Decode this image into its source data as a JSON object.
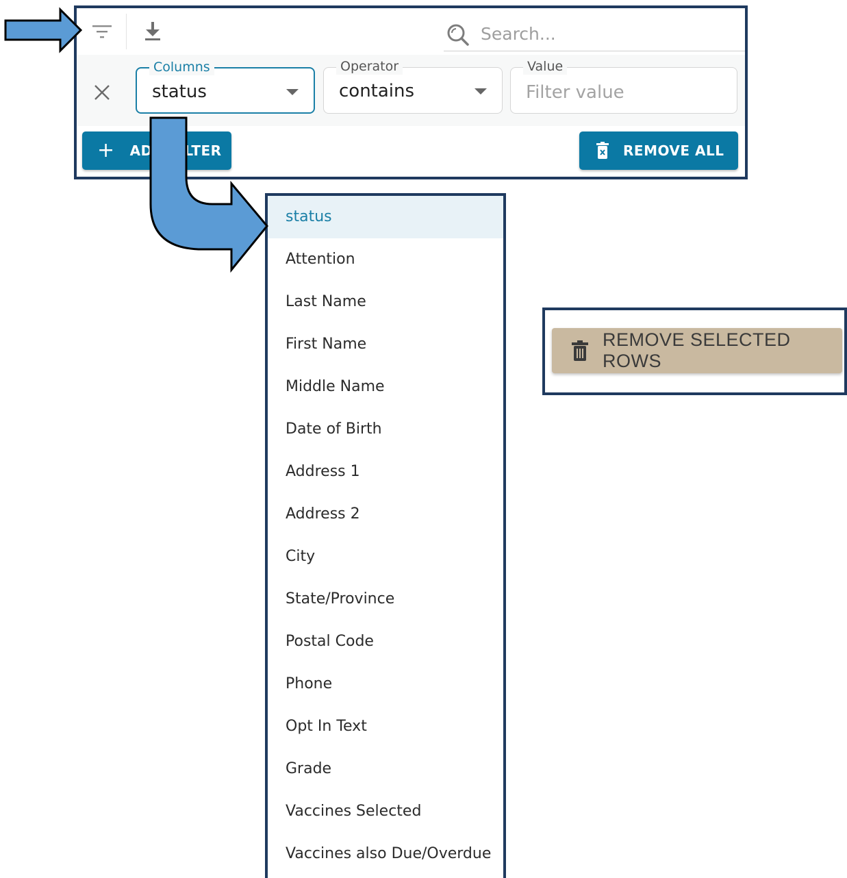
{
  "toolbar": {
    "filter_icon": "filter-list-icon",
    "download_icon": "download-icon",
    "search": {
      "icon": "search-icon",
      "placeholder": "Search..."
    }
  },
  "filter_row": {
    "remove_icon": "close-icon",
    "columns": {
      "label": "Columns",
      "value": "status"
    },
    "operator": {
      "label": "Operator",
      "value": "contains"
    },
    "value": {
      "label": "Value",
      "placeholder": "Filter value"
    }
  },
  "actions": {
    "add_filter_label": "ADD FILTER",
    "remove_all_label": "REMOVE ALL"
  },
  "column_options": [
    "status",
    "Attention",
    "Last Name",
    "First Name",
    "Middle Name",
    "Date of Birth",
    "Address 1",
    "Address 2",
    "City",
    "State/Province",
    "Postal Code",
    "Phone",
    "Opt In Text",
    "Grade",
    "Vaccines Selected",
    "Vaccines also Due/Overdue"
  ],
  "selected_column": "status",
  "remove_selected": {
    "label": "REMOVE SELECTED ROWS",
    "icon": "trash-icon"
  },
  "colors": {
    "accent": "#0b79a4",
    "frame": "#1f3a5f",
    "annotation_arrow": "#5b9bd5",
    "remove_selected_bg": "#c9b9a0"
  }
}
